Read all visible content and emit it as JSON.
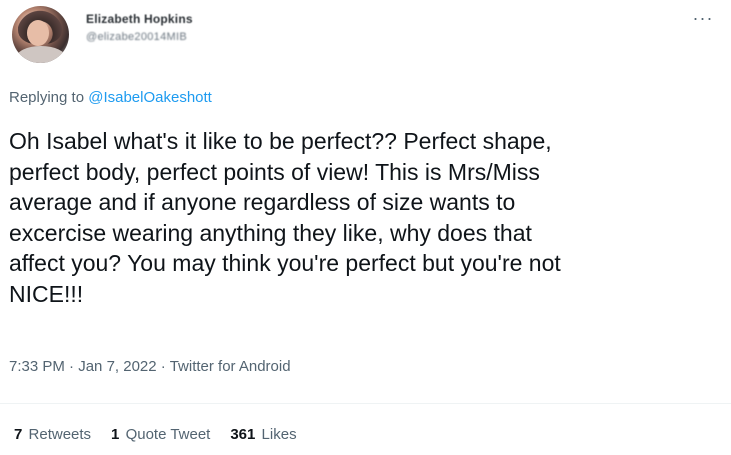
{
  "author": {
    "name": "Elizabeth Hopkins",
    "handle": "@elizabe20014MIB"
  },
  "more_icon": "ellipsis-icon",
  "reply": {
    "prefix": "Replying to ",
    "mention": "@IsabelOakeshott"
  },
  "tweet_text": "Oh Isabel what's it like to be perfect?? Perfect shape,\nperfect body, perfect points of view! This is Mrs/Miss\naverage and if anyone regardless of size wants to\nexcercise wearing anything they like, why does that\naffect you? You may think you're perfect but you're not\nNICE!!!",
  "meta": {
    "time": "7:33 PM",
    "sep1": " · ",
    "date": "Jan 7, 2022",
    "sep2": " · ",
    "source": "Twitter for Android"
  },
  "stats": {
    "retweets_count": "7",
    "retweets_label": "Retweets",
    "quotes_count": "1",
    "quotes_label": "Quote Tweet",
    "likes_count": "361",
    "likes_label": "Likes"
  },
  "colors": {
    "link": "#1d9bf0",
    "secondary_text": "#536471",
    "primary_text": "#0f1419"
  }
}
